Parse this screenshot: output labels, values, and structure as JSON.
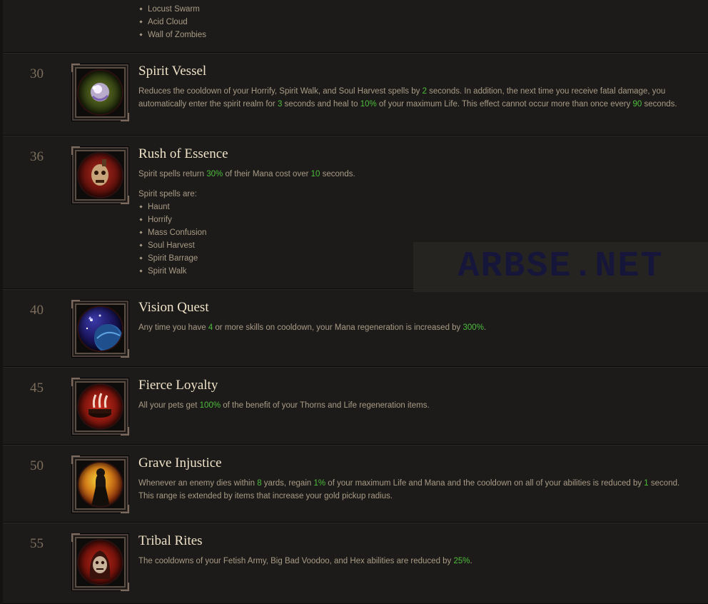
{
  "top_list": [
    "Locust Swarm",
    "Acid Cloud",
    "Wall of Zombies"
  ],
  "watermark": "ARBSE.NET",
  "skills": [
    {
      "level": "30",
      "icon": "spirit-vessel-icon",
      "name": "Spirit Vessel",
      "desc": [
        {
          "t": "Reduces the cooldown of your Horrify, Spirit Walk, and Soul Harvest spells by "
        },
        {
          "t": "2",
          "h": true
        },
        {
          "t": " seconds. In addition, the next time you receive fatal damage, you automatically enter the spirit realm for "
        },
        {
          "t": "3",
          "h": true
        },
        {
          "t": " seconds and heal to "
        },
        {
          "t": "10%",
          "h": true
        },
        {
          "t": " of your maximum Life. This effect cannot occur more than once every "
        },
        {
          "t": "90",
          "h": true
        },
        {
          "t": " seconds."
        }
      ]
    },
    {
      "level": "36",
      "icon": "rush-of-essence-icon",
      "name": "Rush of Essence",
      "desc": [
        {
          "t": "Spirit spells return "
        },
        {
          "t": "30%",
          "h": true
        },
        {
          "t": " of their Mana cost over "
        },
        {
          "t": "10",
          "h": true
        },
        {
          "t": " seconds."
        }
      ],
      "sublabel": "Spirit spells are:",
      "list": [
        "Haunt",
        "Horrify",
        "Mass Confusion",
        "Soul Harvest",
        "Spirit Barrage",
        "Spirit Walk"
      ]
    },
    {
      "level": "40",
      "icon": "vision-quest-icon",
      "name": "Vision Quest",
      "desc": [
        {
          "t": "Any time you have "
        },
        {
          "t": "4",
          "h": true
        },
        {
          "t": " or more skills on cooldown, your Mana regeneration is increased by "
        },
        {
          "t": "300%",
          "h": true
        },
        {
          "t": "."
        }
      ]
    },
    {
      "level": "45",
      "icon": "fierce-loyalty-icon",
      "name": "Fierce Loyalty",
      "desc": [
        {
          "t": "All your pets get "
        },
        {
          "t": "100%",
          "h": true
        },
        {
          "t": " of the benefit of your Thorns and Life regeneration items."
        }
      ]
    },
    {
      "level": "50",
      "icon": "grave-injustice-icon",
      "name": "Grave Injustice",
      "desc": [
        {
          "t": "Whenever an enemy dies within "
        },
        {
          "t": "8",
          "h": true
        },
        {
          "t": " yards, regain "
        },
        {
          "t": "1%",
          "h": true
        },
        {
          "t": " of your maximum Life and Mana and the cooldown on all of your abilities is reduced by "
        },
        {
          "t": "1",
          "h": true
        },
        {
          "t": " second. This range is extended by items that increase your gold pickup radius."
        }
      ]
    },
    {
      "level": "55",
      "icon": "tribal-rites-icon",
      "name": "Tribal Rites",
      "desc": [
        {
          "t": "The cooldowns of your Fetish Army, Big Bad Voodoo, and Hex abilities are reduced by "
        },
        {
          "t": "25%",
          "h": true
        },
        {
          "t": "."
        }
      ]
    }
  ],
  "colors": {
    "background": "#141311",
    "row": "#1c1b19",
    "title": "#efe2c8",
    "text": "#a99b86",
    "level": "#7c6e5d",
    "highlight": "#4ebd3c"
  }
}
